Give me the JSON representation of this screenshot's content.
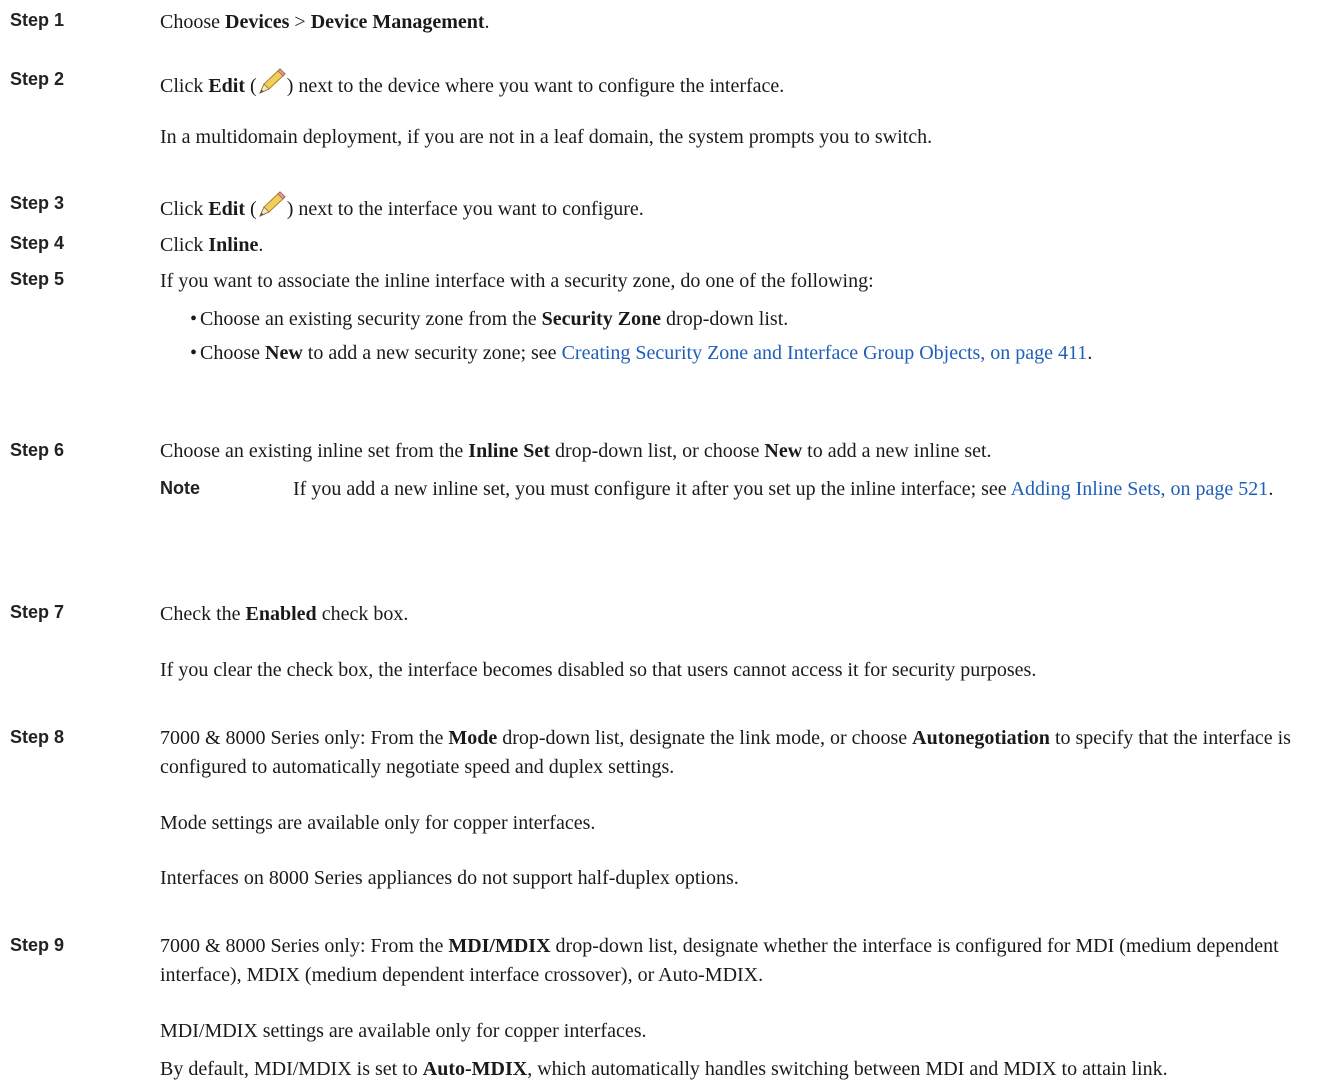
{
  "steps": {
    "s1": {
      "label": "Step 1",
      "t1": "Choose ",
      "b1": "Devices",
      "t2": " > ",
      "b2": "Device Management",
      "t3": "."
    },
    "s2": {
      "label": "Step 2",
      "t1": "Click ",
      "b1": "Edit",
      "t2": " (",
      "t3": ") next to the device where you want to configure the interface.",
      "p2": "In a multidomain deployment, if you are not in a leaf domain, the system prompts you to switch."
    },
    "s3": {
      "label": "Step 3",
      "t1": "Click ",
      "b1": "Edit",
      "t2": " (",
      "t3": ") next to the interface you want to configure."
    },
    "s4": {
      "label": "Step 4",
      "t1": "Click ",
      "b1": "Inline",
      "t2": "."
    },
    "s5": {
      "label": "Step 5",
      "t1": "If you want to associate the inline interface with a security zone, do one of the following:",
      "bullet1": {
        "t1": "Choose an existing security zone from the ",
        "b1": "Security Zone",
        "t2": " drop-down list."
      },
      "bullet2": {
        "t1": "Choose ",
        "b1": "New",
        "t2": " to add a new security zone; see ",
        "link": "Creating Security Zone and Interface Group Objects, on page 411",
        "t3": "."
      }
    },
    "s6": {
      "label": "Step 6",
      "t1": "Choose an existing inline set from the ",
      "b1": "Inline Set",
      "t2": " drop-down list, or choose ",
      "b2": "New",
      "t3": " to add a new inline set.",
      "note_label": "Note",
      "note": {
        "t1": "If you add a new inline set, you must configure it after you set up the inline interface; see ",
        "link": "Adding Inline Sets, on page 521",
        "t2": "."
      }
    },
    "s7": {
      "label": "Step 7",
      "t1": "Check the ",
      "b1": "Enabled",
      "t2": " check box.",
      "p2": "If you clear the check box, the interface becomes disabled so that users cannot access it for security purposes."
    },
    "s8": {
      "label": "Step 8",
      "t1": "7000 & 8000 Series only: From the ",
      "b1": "Mode",
      "t2": " drop-down list, designate the link mode, or choose ",
      "b2": "Autonegotiation",
      "t3": " to specify that the interface is configured to automatically negotiate speed and duplex settings.",
      "p2": "Mode settings are available only for copper interfaces.",
      "p3": "Interfaces on 8000 Series appliances do not support half-duplex options."
    },
    "s9": {
      "label": "Step 9",
      "t1": "7000 & 8000 Series only: From the ",
      "b1": "MDI/MDIX",
      "t2": " drop-down list, designate whether the interface is configured for MDI (medium dependent interface), MDIX (medium dependent interface crossover), or Auto-MDIX.",
      "p2": "MDI/MDIX settings are available only for copper interfaces.",
      "p3": {
        "t1": "By default, MDI/MDIX is set to ",
        "b1": "Auto-MDIX",
        "t2": ", which automatically handles switching between MDI and MDIX to attain link."
      }
    }
  },
  "icons": {
    "edit": "pencil-edit-icon"
  },
  "colors": {
    "link": "#1f5fb8",
    "pencil": "#e8c24a"
  }
}
